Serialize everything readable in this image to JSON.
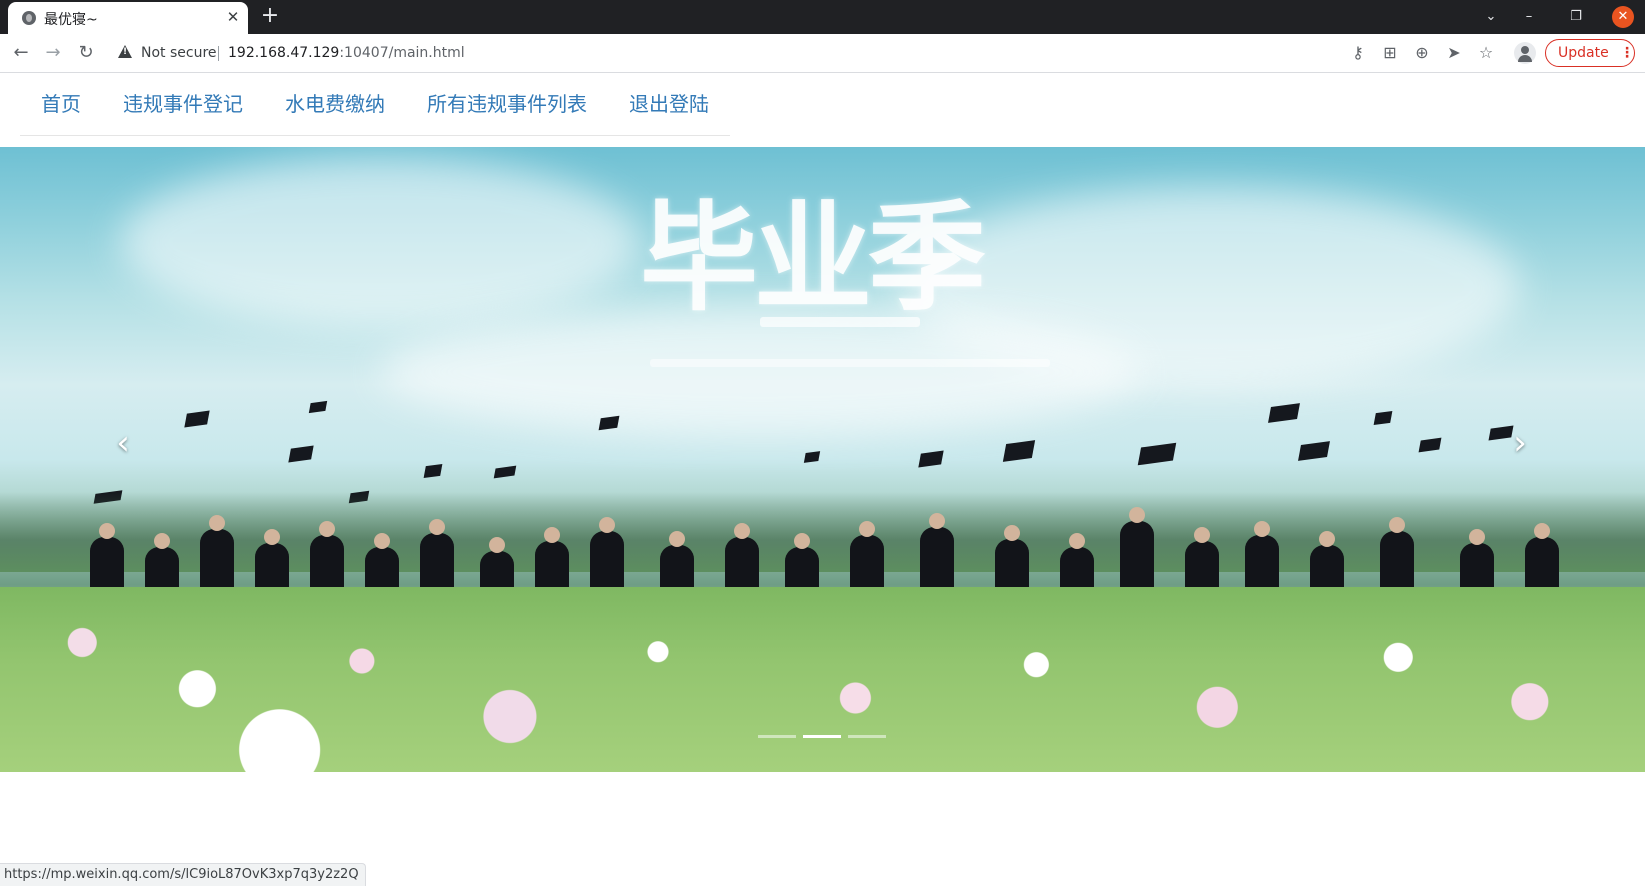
{
  "browser": {
    "tab_title": "最优寝~",
    "tab_close": "✕",
    "new_tab": "+",
    "security_label": "Not secure",
    "url_host": "192.168.47.129",
    "url_path": ":10407/main.html",
    "update_label": "Update",
    "update_dots": "⋮",
    "status_url": "https://mp.weixin.qq.com/s/lC9ioL87OvK3xp7q3y2z2Q"
  },
  "nav": {
    "items": [
      "首页",
      "违规事件登记",
      "水电费缴纳",
      "所有违规事件列表",
      "退出登陆"
    ],
    "color": "#337ab7"
  },
  "carousel": {
    "slogan": "毕业季",
    "prev": "‹",
    "next": "›",
    "slide_count": 3,
    "active_index": 1
  },
  "icons": {
    "back": "back-icon",
    "forward": "forward-icon",
    "reload": "reload-icon",
    "key": "key-icon",
    "translate": "translate-icon",
    "zoom": "zoom-icon",
    "send": "send-icon",
    "star": "star-icon"
  },
  "colors": {
    "chrome_dark": "#202124",
    "update_red": "#d93025",
    "close_orange": "#e95420"
  }
}
